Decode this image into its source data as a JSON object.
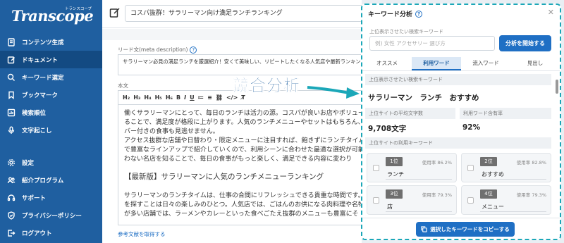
{
  "app": {
    "logo": "Transcope",
    "logo_sub": "トランスコープ"
  },
  "sidebar": {
    "top_items": [
      {
        "label": "コンテンツ生成",
        "icon": "document-icon"
      },
      {
        "label": "ドキュメント",
        "icon": "edit-icon",
        "active": true
      },
      {
        "label": "キーワード選定",
        "icon": "search-icon"
      },
      {
        "label": "ブックマーク",
        "icon": "bookmark-icon"
      },
      {
        "label": "検索順位",
        "icon": "chart-icon"
      },
      {
        "label": "文字起こし",
        "icon": "microphone-icon"
      }
    ],
    "bottom_items": [
      {
        "label": "設定",
        "icon": "gear-icon"
      },
      {
        "label": "紹介プログラム",
        "icon": "people-icon"
      },
      {
        "label": "サポート",
        "icon": "support-icon"
      },
      {
        "label": "プライバシーポリシー",
        "icon": "shield-icon"
      },
      {
        "label": "ログアウト",
        "icon": "logout-icon"
      }
    ]
  },
  "editor": {
    "title": "コスパ抜群！サラリーマン向け満足ランチランキング",
    "meta_label": "リード文(meta description)",
    "meta_text": "サラリーマン必見の満足ランチを厳選紹介！安くて美味しい、リピートしたくなる人気店や最新ランキング満載です",
    "body_label": "本文",
    "toolbar": [
      "H₂",
      "H₃",
      "H₄",
      "H₅",
      "H₆",
      "B",
      "I",
      "U",
      "≔",
      "≡",
      "⛓",
      "</>",
      "T̸"
    ],
    "paragraphs": [
      "働くサラリーマンにとって、毎日のランチは活力の源。コスパが良いお店やボリュー",
      "ることで、満足度が格段に上がります。人気のランチメニューやセットはもちろん、",
      "バー付きの食事も見逃せません。",
      "アクセス抜群な店舗や日替わり・限定メニューに注目すれば、飽きずにランチタイム",
      "で豊富なラインアップで紹介していくので、利用シーンに合わせた最適な選択が可能",
      "わない名店を知ることで、毎日の食事がもっと楽しく、満足できる内容に変わり"
    ],
    "heading": "【最新版】サラリーマンに人気のランチメニューランキング",
    "paragraphs2": [
      "サラリーマンのランチタイムは、仕事の合間にリフレッシュできる貴重な時間です。",
      "を探すことは日々の楽しみのひとつ。人気店では、ごはんのお供になる肉料理や名物",
      "が多い店舗では、ラーメンやカレーといった食べごたえ抜群のメニューも豊富にそ"
    ],
    "ref_link": "参考文献を取得する"
  },
  "annotation": {
    "label": "競合分析",
    "arrow_color": "#1ba7b8"
  },
  "panel": {
    "title": "キーワード分析",
    "search_label": "上位表示させたい検索キーワード",
    "search_placeholder": "例) 女性 アクセサリー 選び方",
    "start_button": "分析を開始する",
    "tabs": [
      "オススメ",
      "利用ワード",
      "流入ワード",
      "見出し"
    ],
    "active_tab": 1,
    "target_label": "上位表示させたい検索キーワード",
    "target_keywords": "サラリーマン　ランチ　おすすめ",
    "avg_chars_label": "上位サイトの平均文字数",
    "avg_chars_value": "9,708文字",
    "usage_rate_label": "利用ワード含有率",
    "usage_rate_value": "92%",
    "top_words_label": "上位サイトの利用キーワード",
    "words": [
      {
        "rank": "1位",
        "usage": "使用率 86.2%",
        "word": "ランチ"
      },
      {
        "rank": "2位",
        "usage": "使用率 82.8%",
        "word": "おすすめ"
      },
      {
        "rank": "3位",
        "usage": "使用率 79.3%",
        "word": "店"
      },
      {
        "rank": "4位",
        "usage": "使用率 79.3%",
        "word": "メニュー"
      }
    ],
    "copy_button": "選択したキーワードをコピーする",
    "accent": "#1f6fc4",
    "border_color": "#1ba7b8"
  }
}
